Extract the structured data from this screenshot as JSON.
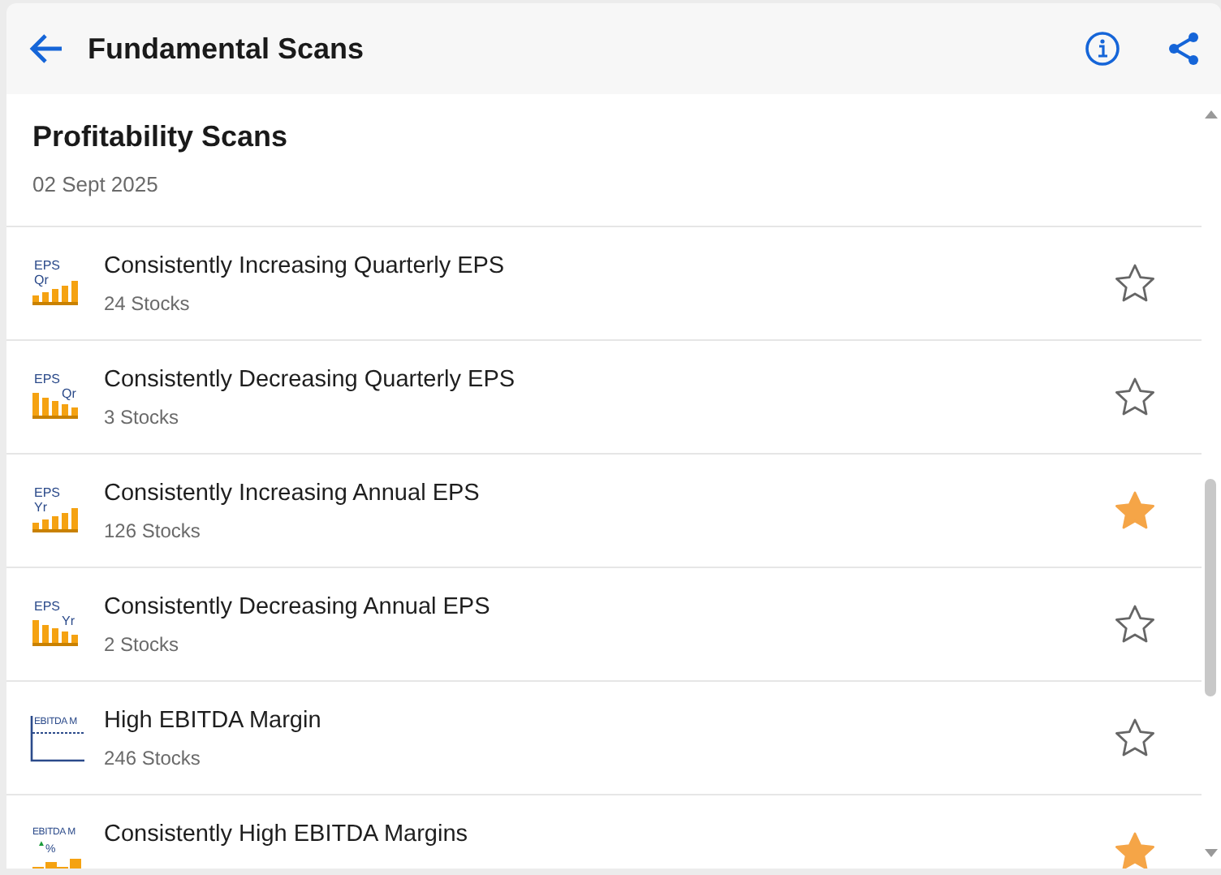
{
  "header": {
    "title": "Fundamental Scans"
  },
  "section": {
    "title": "Profitability Scans",
    "date": "02 Sept 2025"
  },
  "scans": [
    {
      "name": "Consistently Increasing Quarterly EPS",
      "count": "24 Stocks",
      "starred": false,
      "icon": {
        "kind": "rising",
        "labels": [
          "EPS",
          "Qr"
        ]
      }
    },
    {
      "name": "Consistently Decreasing Quarterly EPS",
      "count": "3 Stocks",
      "starred": false,
      "icon": {
        "kind": "falling",
        "labels": [
          "EPS",
          "Qr"
        ]
      }
    },
    {
      "name": "Consistently Increasing Annual EPS",
      "count": "126 Stocks",
      "starred": true,
      "icon": {
        "kind": "rising",
        "labels": [
          "EPS",
          "Yr"
        ]
      }
    },
    {
      "name": "Consistently Decreasing Annual EPS",
      "count": "2 Stocks",
      "starred": false,
      "icon": {
        "kind": "falling",
        "labels": [
          "EPS",
          "Yr"
        ]
      }
    },
    {
      "name": "High EBITDA Margin",
      "count": "246 Stocks",
      "starred": false,
      "icon": {
        "kind": "threshold",
        "labels": [
          "EBITDA M"
        ]
      }
    },
    {
      "name": "Consistently High EBITDA Margins",
      "starred": true,
      "icon": {
        "kind": "margin",
        "labels": [
          "EBITDA M",
          "▲",
          "%"
        ]
      }
    }
  ]
}
